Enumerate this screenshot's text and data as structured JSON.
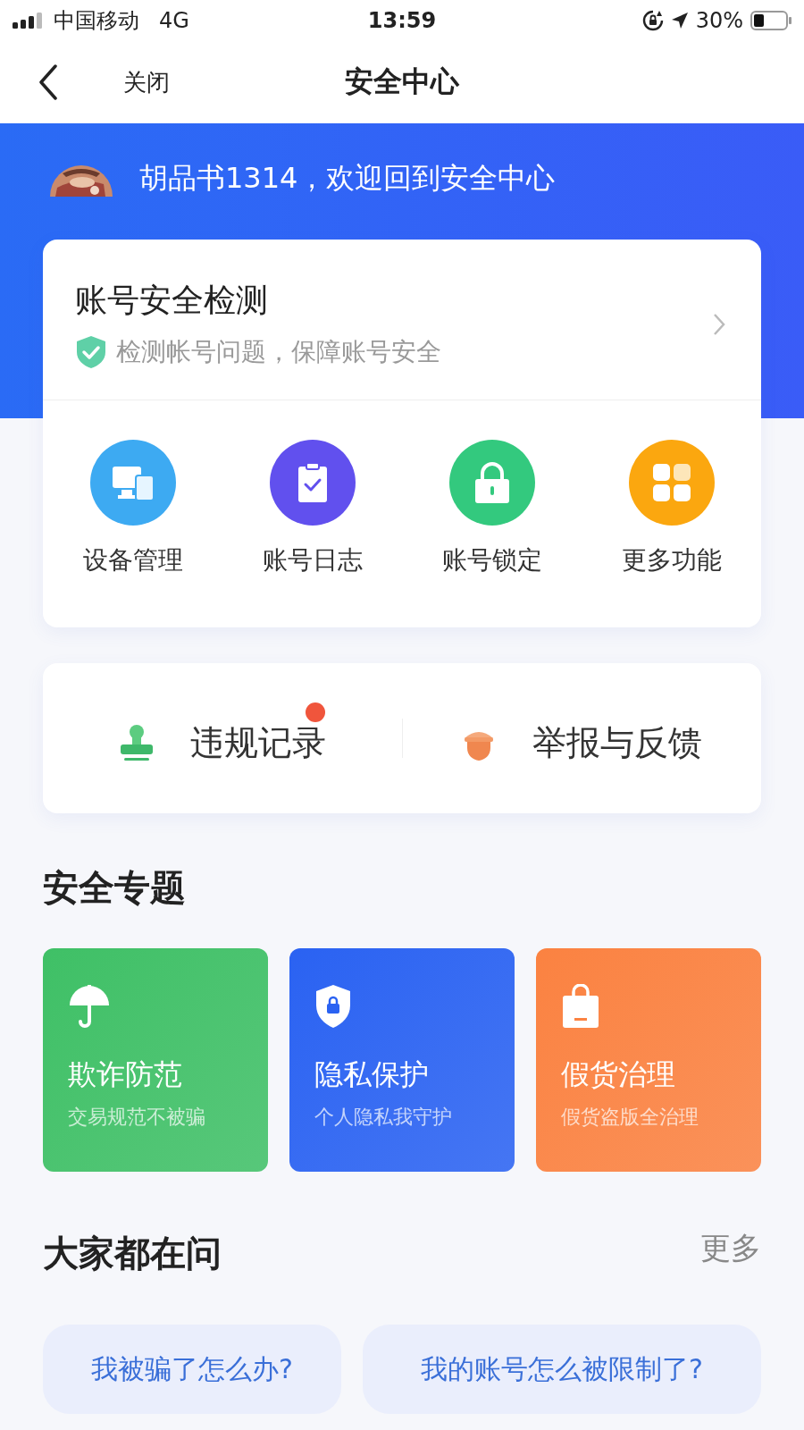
{
  "status_bar": {
    "carrier": "中国移动",
    "network": "4G",
    "time": "13:59",
    "battery": "30%"
  },
  "nav": {
    "close": "关闭",
    "title": "安全中心"
  },
  "greeting": "胡品书1314，欢迎回到安全中心",
  "check_card": {
    "title": "账号安全检测",
    "subtitle": "检测帐号问题，保障账号安全"
  },
  "features": [
    {
      "label": "设备管理",
      "color": "#3daaf2"
    },
    {
      "label": "账号日志",
      "color": "#6150ee"
    },
    {
      "label": "账号锁定",
      "color": "#33c97e"
    },
    {
      "label": "更多功能",
      "color": "#fba70f"
    }
  ],
  "shortcuts": [
    {
      "label": "违规记录",
      "badge": true
    },
    {
      "label": "举报与反馈",
      "badge": false
    }
  ],
  "topics_title": "安全专题",
  "topics": [
    {
      "title": "欺诈防范",
      "subtitle": "交易规范不被骗",
      "color": "#3fc066"
    },
    {
      "title": "隐私保护",
      "subtitle": "个人隐私我守护",
      "color": "#2a62f2"
    },
    {
      "title": "假货治理",
      "subtitle": "假货盗版全治理",
      "color": "#fb8241"
    }
  ],
  "faq_title": "大家都在问",
  "faq_more": "更多",
  "questions": [
    "我被骗了怎么办?",
    "我的账号怎么被限制了?"
  ]
}
